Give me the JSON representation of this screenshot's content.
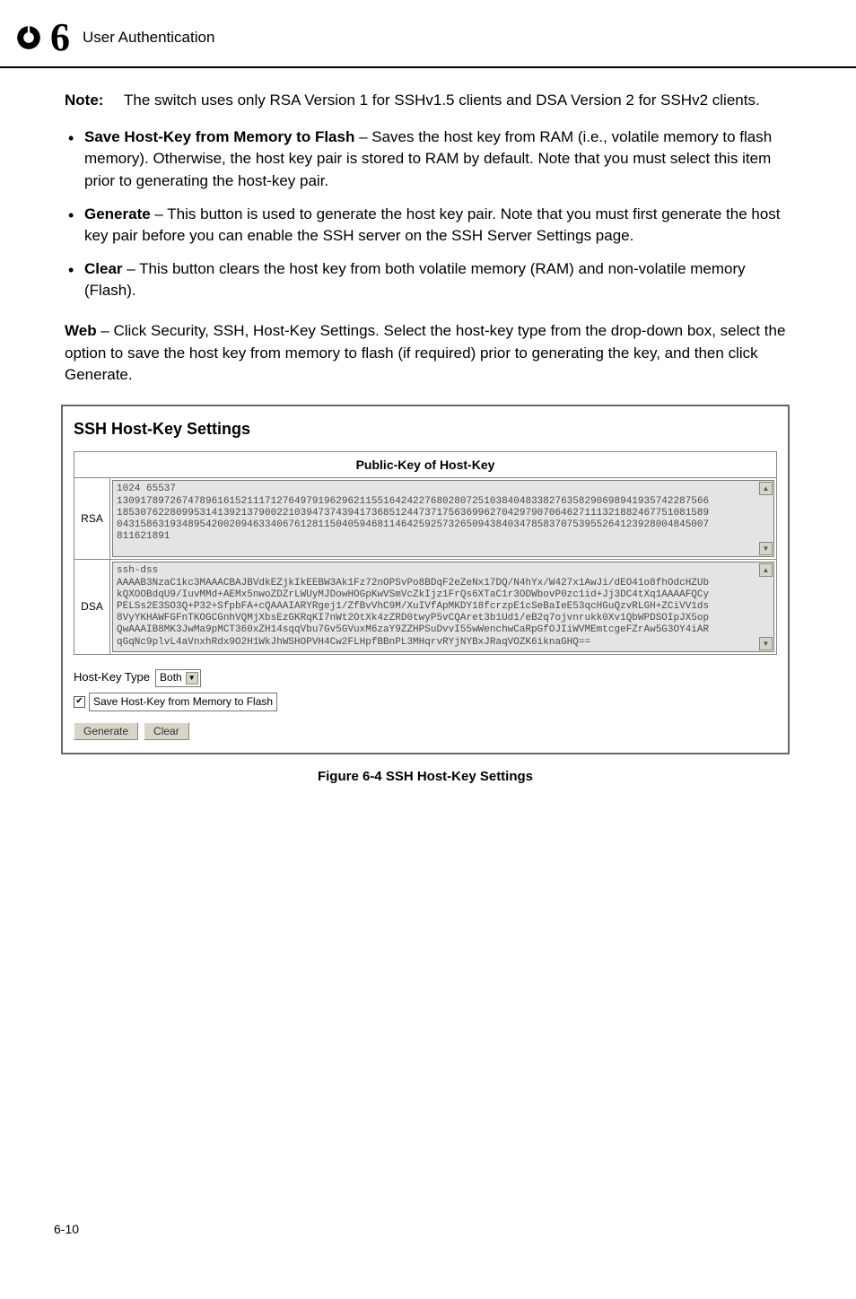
{
  "header": {
    "chapter_number": "6",
    "chapter_title": "User Authentication"
  },
  "note": {
    "label": "Note:",
    "text": "The switch uses only RSA Version 1 for SSHv1.5 clients and DSA Version 2 for SSHv2 clients."
  },
  "bullets": [
    {
      "term": "Save Host-Key from Memory to Flash",
      "desc": " – Saves the host key from RAM (i.e., volatile memory to flash memory). Otherwise, the host key pair is stored to RAM by default. Note that you must select this item prior to generating the host-key pair."
    },
    {
      "term": "Generate",
      "desc": " – This button is used to generate the host key pair. Note that you must first generate the host key pair before you can enable the SSH server on the SSH Server Settings page."
    },
    {
      "term": "Clear",
      "desc": " – This button clears the host key from both volatile memory (RAM) and non-volatile memory (Flash)."
    }
  ],
  "web": {
    "label": "Web",
    "text": " – Click Security, SSH, Host-Key Settings. Select the host-key type from the drop-down box, select the option to save the host key from memory to flash (if required) prior to generating the key, and then click Generate."
  },
  "panel": {
    "title": "SSH Host-Key Settings",
    "pk_header": "Public-Key of Host-Key",
    "rsa_label": "RSA",
    "dsa_label": "DSA",
    "rsa_text": "1024 65537\n1309178972674789616152111712764979196296211551642422768028072510384048338276358290698941935742287566\n1853076228099531413921379002210394737439417368512447371756369962704297907064627111321882467751081589\n0431586319348954200209463340676128115040594681146425925732650943840347858370753955264123928004845007\n811621891",
    "dsa_text": "ssh-dss\nAAAAB3NzaC1kc3MAAACBAJBVdkEZjkIkEEBW3Ak1Fz72nOPSvPo8BDqF2eZeNx17DQ/N4hYx/W427x1AwJi/dEO41o8fhOdcHZUb\nkQXOOBdqU9/IuvMMd+AEMx5nwoZDZrLWUyMJDowHOGpKwVSmVcZkIjz1FrQs6XTaC1r3ODWbovP0zc1id+Jj3DC4tXq1AAAAFQCy\nPELSs2E3SO3Q+P32+SfpbFA+cQAAAIARYRgej1/ZfBvVhC9M/XuIVfApMKDY18fcrzpE1cSeBaIeE53qcHGuQzvRLGH+ZCiVV1ds\n8VyYKHAWFGFnTKOGCGnhVQMjXbsEzGKRqKI7nWt2OtXk4zZRD0twyP5vCQAret3b1Ud1/eB2q7ojvnrukk0Xv1QbWPDSOIpJX5op\nQwAAAIB8MK3JwMa9pMCT360xZH14sqqVbu7Gv5GVuxM6zaY9ZZHPSuDvvI55wWenchwCaRpGfOJIiWVMEmtcgeFZrAw5G3OY4iAR\nqGqNc9plvL4aVnxhRdx9O2H1WkJhWSHOPVH4Cw2FLHpfBBnPL3MHqrvRYjNYBxJRaqVOZK6iknaGHQ==",
    "host_key_type_label": "Host-Key Type",
    "host_key_type_value": "Both",
    "save_checkbox_label": "Save Host-Key from Memory to Flash",
    "generate_btn": "Generate",
    "clear_btn": "Clear"
  },
  "figure_caption": "Figure 6-4   SSH Host-Key Settings",
  "page_number": "6-10"
}
